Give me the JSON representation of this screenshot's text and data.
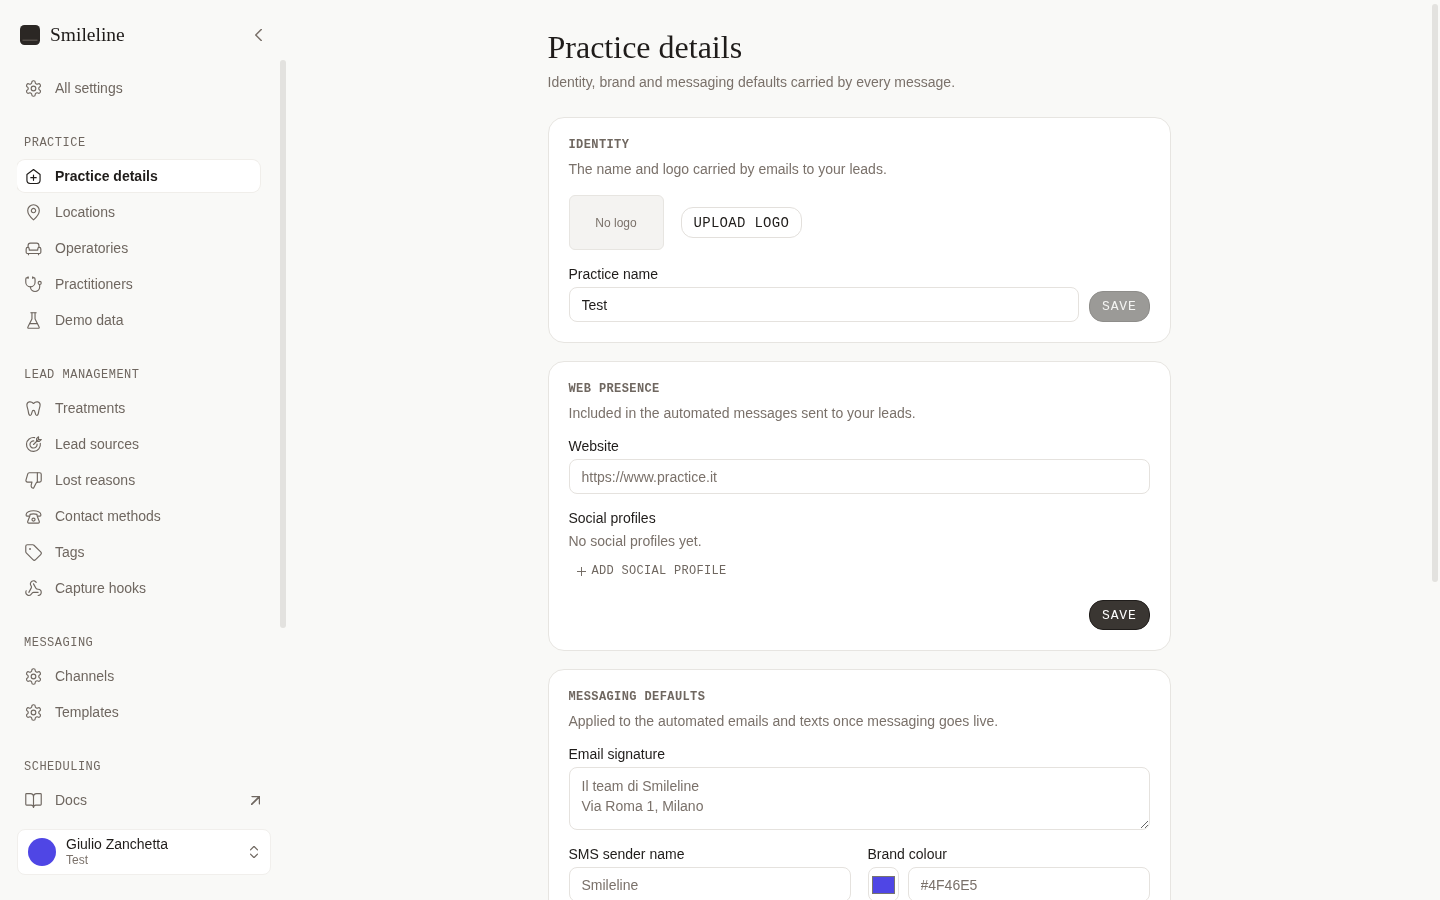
{
  "sidebar": {
    "brand": "Smileline",
    "top_item": {
      "label": "All settings",
      "kind": "page",
      "selected": false
    },
    "sections": [
      {
        "title": "PRACTICE",
        "items": [
          {
            "label": "Practice details",
            "kind": "page",
            "selected": true
          },
          {
            "label": "Locations",
            "kind": "page",
            "selected": false
          },
          {
            "label": "Operatories",
            "kind": "page",
            "selected": false
          },
          {
            "label": "Practitioners",
            "kind": "page",
            "selected": false
          },
          {
            "label": "Demo data",
            "kind": "page",
            "selected": false
          }
        ]
      },
      {
        "title": "LEAD MANAGEMENT",
        "items": [
          {
            "label": "Treatments",
            "kind": "page",
            "selected": false
          },
          {
            "label": "Lead sources",
            "kind": "page",
            "selected": false
          },
          {
            "label": "Lost reasons",
            "kind": "page",
            "selected": false
          },
          {
            "label": "Contact methods",
            "kind": "page",
            "selected": false
          },
          {
            "label": "Tags",
            "kind": "page",
            "selected": false
          },
          {
            "label": "Capture hooks",
            "kind": "page",
            "selected": false
          }
        ]
      },
      {
        "title": "MESSAGING",
        "items": [
          {
            "label": "Channels",
            "kind": "page",
            "selected": false
          },
          {
            "label": "Templates",
            "kind": "page",
            "selected": false
          }
        ]
      },
      {
        "title": "SCHEDULING",
        "items": [
          {
            "label": "Docs",
            "kind": "external",
            "selected": false
          }
        ]
      }
    ],
    "user": {
      "name": "Giulio Zanchetta",
      "subtitle": "Test"
    }
  },
  "page": {
    "title": "Practice details",
    "subtitle": "Identity, brand and messaging defaults carried by every message."
  },
  "cards": [
    {
      "kind": "identity",
      "heading": "IDENTITY",
      "description": "The name and logo carried by emails to your leads.",
      "logo_placeholder": "No logo",
      "upload_button": "UPLOAD LOGO",
      "fields": [
        {
          "label": "Practice name",
          "value": "Test"
        }
      ],
      "save": {
        "label": "SAVE",
        "disabled": true
      }
    },
    {
      "kind": "web",
      "heading": "WEB PRESENCE",
      "description": "Included in the automated messages sent to your leads.",
      "fields": [
        {
          "label": "Website",
          "placeholder": "https://www.practice.it"
        }
      ],
      "social": {
        "label": "Social profiles",
        "empty_text": "No social profiles yet.",
        "add_button": "ADD SOCIAL PROFILE"
      },
      "save": {
        "label": "SAVE",
        "disabled": false
      }
    },
    {
      "kind": "messaging",
      "heading": "MESSAGING DEFAULTS",
      "description": "Applied to the automated emails and texts once messaging goes live.",
      "signature": {
        "label": "Email signature",
        "placeholder": "Il team di Smileline\nVia Roma 1, Milano"
      },
      "sms": {
        "label": "SMS sender name",
        "placeholder": "Smileline"
      },
      "brand_colour": {
        "label": "Brand colour",
        "placeholder": "#4F46E5",
        "color": "#4f46e5"
      }
    }
  ]
}
